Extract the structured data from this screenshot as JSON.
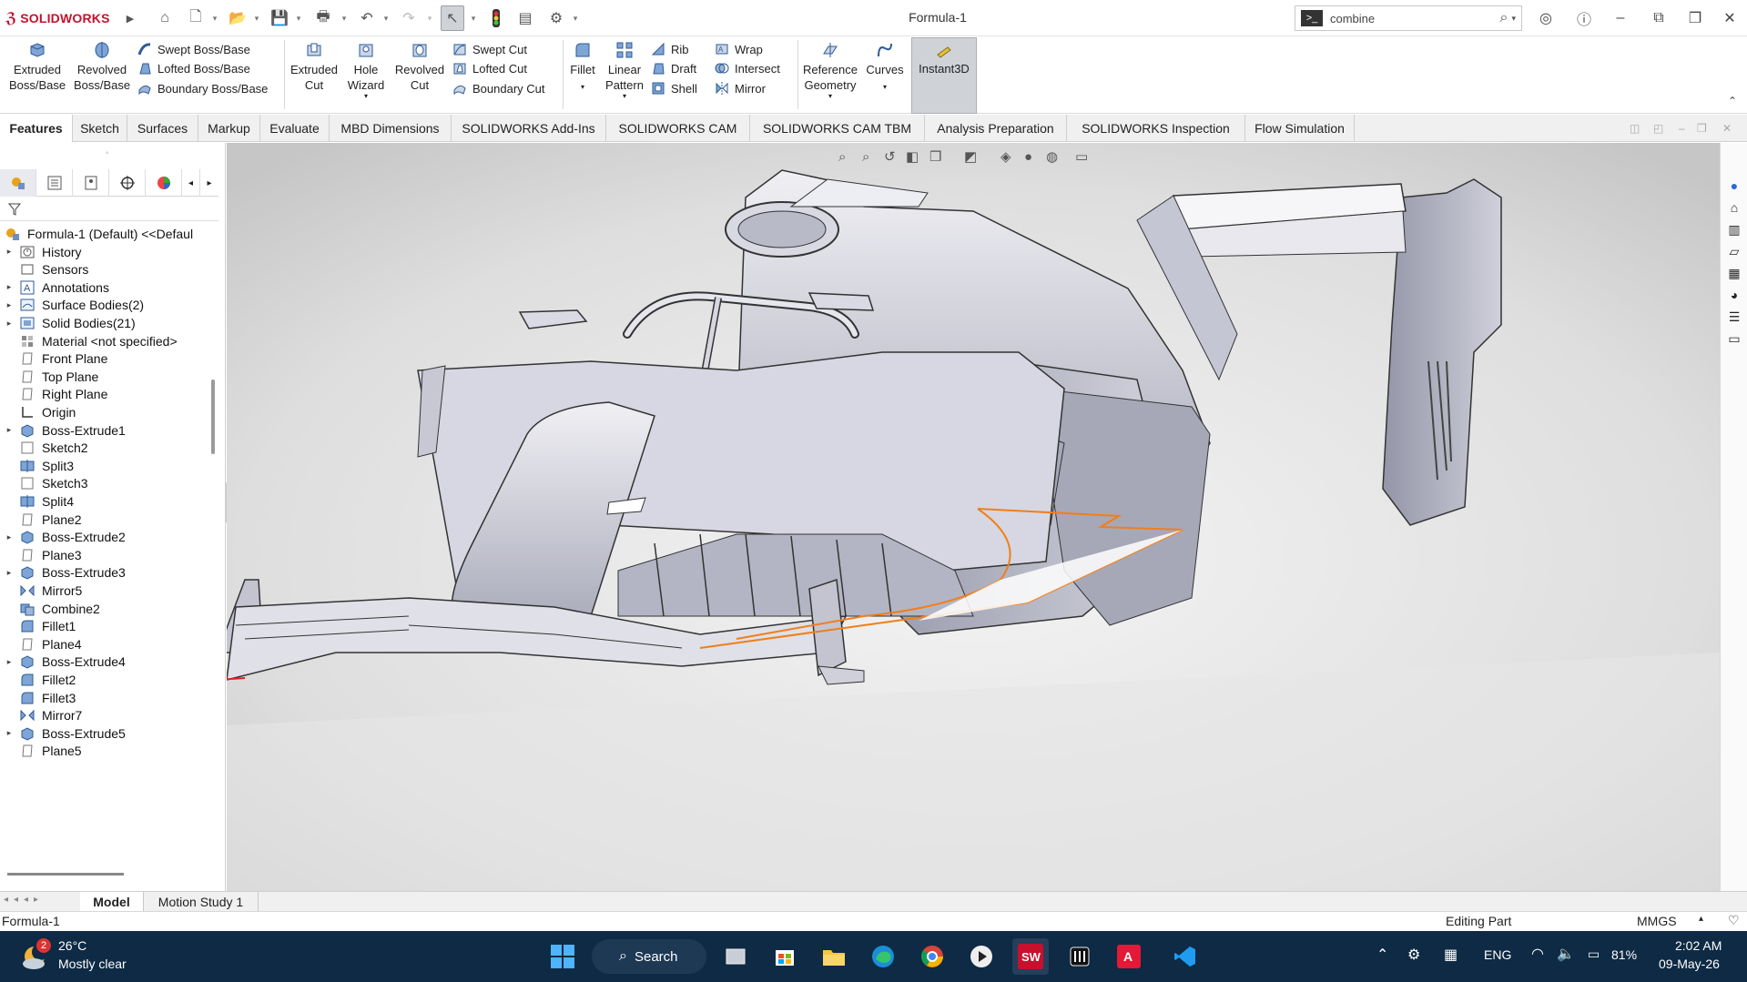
{
  "window": {
    "brand": "SOLIDWORKS",
    "title": "Formula-1"
  },
  "search": {
    "value": "combine"
  },
  "ribbon": {
    "extruded_boss": "Extruded Boss/Base",
    "revolved_boss": "Revolved Boss/Base",
    "swept_boss": "Swept Boss/Base",
    "lofted_boss": "Lofted Boss/Base",
    "boundary_boss": "Boundary Boss/Base",
    "extruded_cut": "Extruded Cut",
    "hole_wizard": "Hole Wizard",
    "revolved_cut": "Revolved Cut",
    "swept_cut": "Swept Cut",
    "lofted_cut": "Lofted Cut",
    "boundary_cut": "Boundary Cut",
    "fillet": "Fillet",
    "linear_pattern": "Linear Pattern",
    "rib": "Rib",
    "draft": "Draft",
    "shell": "Shell",
    "wrap": "Wrap",
    "intersect": "Intersect",
    "mirror": "Mirror",
    "reference_geometry": "Reference Geometry",
    "curves": "Curves",
    "instant3d": "Instant3D"
  },
  "tabs": [
    "Features",
    "Sketch",
    "Surfaces",
    "Markup",
    "Evaluate",
    "MBD Dimensions",
    "SOLIDWORKS Add-Ins",
    "SOLIDWORKS CAM",
    "SOLIDWORKS CAM TBM",
    "Analysis Preparation",
    "SOLIDWORKS Inspection",
    "Flow Simulation"
  ],
  "tree": {
    "root": "Formula-1 (Default) <<Defaul",
    "items": [
      {
        "label": "History",
        "icon": "history-icon",
        "expand": true
      },
      {
        "label": "Sensors",
        "icon": "sensor-icon",
        "expand": false
      },
      {
        "label": "Annotations",
        "icon": "annotation-icon",
        "expand": true
      },
      {
        "label": "Surface Bodies(2)",
        "icon": "surface-bodies-icon",
        "expand": true
      },
      {
        "label": "Solid Bodies(21)",
        "icon": "solid-bodies-icon",
        "expand": true
      },
      {
        "label": "Material <not specified>",
        "icon": "material-icon",
        "expand": false
      },
      {
        "label": "Front Plane",
        "icon": "plane-icon",
        "expand": false
      },
      {
        "label": "Top Plane",
        "icon": "plane-icon",
        "expand": false
      },
      {
        "label": "Right Plane",
        "icon": "plane-icon",
        "expand": false
      },
      {
        "label": "Origin",
        "icon": "origin-icon",
        "expand": false
      },
      {
        "label": "Boss-Extrude1",
        "icon": "extrude-icon",
        "expand": true
      },
      {
        "label": "Sketch2",
        "icon": "sketch-icon",
        "expand": false
      },
      {
        "label": "Split3",
        "icon": "split-icon",
        "expand": false
      },
      {
        "label": "Sketch3",
        "icon": "sketch-icon",
        "expand": false
      },
      {
        "label": "Split4",
        "icon": "split-icon",
        "expand": false
      },
      {
        "label": "Plane2",
        "icon": "plane-icon",
        "expand": false
      },
      {
        "label": "Boss-Extrude2",
        "icon": "extrude-icon",
        "expand": true
      },
      {
        "label": "Plane3",
        "icon": "plane-icon",
        "expand": false
      },
      {
        "label": "Boss-Extrude3",
        "icon": "extrude-icon",
        "expand": true
      },
      {
        "label": "Mirror5",
        "icon": "mirror-icon",
        "expand": false
      },
      {
        "label": "Combine2",
        "icon": "combine-icon",
        "expand": false
      },
      {
        "label": "Fillet1",
        "icon": "fillet-icon",
        "expand": false
      },
      {
        "label": "Plane4",
        "icon": "plane-icon",
        "expand": false
      },
      {
        "label": "Boss-Extrude4",
        "icon": "extrude-icon",
        "expand": true
      },
      {
        "label": "Fillet2",
        "icon": "fillet-icon",
        "expand": false
      },
      {
        "label": "Fillet3",
        "icon": "fillet-icon",
        "expand": false
      },
      {
        "label": "Mirror7",
        "icon": "mirror-icon",
        "expand": false
      },
      {
        "label": "Boss-Extrude5",
        "icon": "extrude-icon",
        "expand": true
      },
      {
        "label": "Plane5",
        "icon": "plane-icon",
        "expand": false
      }
    ]
  },
  "bottom_tabs": {
    "model": "Model",
    "motion": "Motion Study 1"
  },
  "status": {
    "left": "Formula-1",
    "mode": "Editing Part",
    "units": "MMGS"
  },
  "taskbar": {
    "weather_temp": "26°C",
    "weather_desc": "Mostly clear",
    "weather_badge": "2",
    "search": "Search",
    "lang": "ENG",
    "battery": "81%",
    "time": "2:02 AM",
    "date": "09-May-26"
  },
  "colors": {
    "accent": "#c8102e",
    "sketch": "#f07f1a",
    "taskbar": "#0e2a44"
  }
}
